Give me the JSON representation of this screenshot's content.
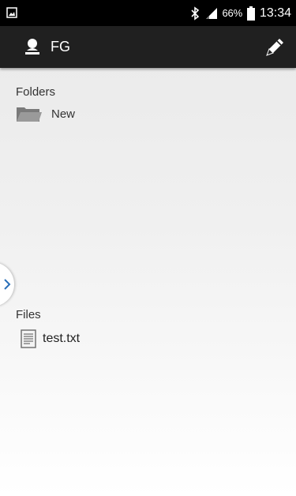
{
  "status_bar": {
    "battery_percent": "66%",
    "time": "13:34",
    "left_icon": "screenshot-notification-icon",
    "icons": [
      "bluetooth-icon",
      "signal-icon",
      "battery-icon"
    ]
  },
  "app_bar": {
    "title": "FG",
    "user_icon": "user-icon",
    "edit_icon": "edit-pencil-icon"
  },
  "folders": {
    "label": "Folders",
    "items": [
      {
        "name": "New",
        "icon": "folder-icon"
      }
    ]
  },
  "files": {
    "label": "Files",
    "items": [
      {
        "name": "test.txt",
        "icon": "text-file-icon"
      }
    ]
  },
  "drawer_handle": {
    "icon": "chevron-right-icon"
  },
  "colors": {
    "status_bar": "#000000",
    "app_bar": "#202020",
    "background_top": "#e9e9e9",
    "background_bottom": "#ffffff",
    "chevron": "#2a6fb8"
  }
}
